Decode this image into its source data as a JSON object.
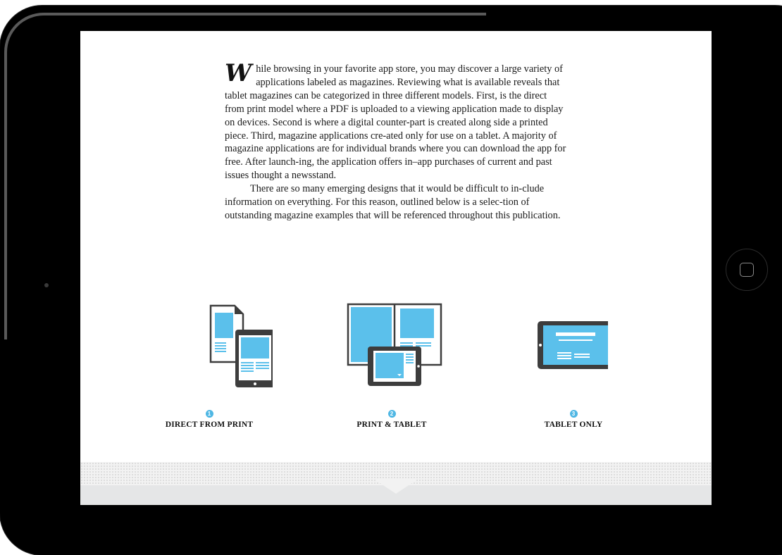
{
  "article": {
    "dropcap": "W",
    "paragraph1": "hile browsing in your favorite app store, you may discover a large variety of applications labeled as magazines. Reviewing what is available reveals that tablet magazines can be categorized in three different models. First, is the direct from print model where a PDF is uploaded to a viewing application made to display on devices. Second is where a digital counter-part is created along side a printed piece. Third, magazine applications cre-ated only for use on a tablet. A majority of magazine applications are for individual brands where you can download the app for free. After launch-ing, the application offers in–app purchases of current and past issues thought a newsstand.",
    "paragraph2": "There are so many emerging designs that it would be difficult to in-clude information on everything. For this reason, outlined below is a selec-tion of outstanding magazine examples that will be referenced throughout this publication."
  },
  "models": [
    {
      "number": "1",
      "label": "DIRECT FROM PRINT"
    },
    {
      "number": "2",
      "label": "PRINT & TABLET"
    },
    {
      "number": "3",
      "label": "TABLET ONLY"
    }
  ],
  "colors": {
    "accent": "#5bc0eb",
    "device": "#3d3d3d",
    "number_badge": "#4fb7e4",
    "bezel": "#000000"
  },
  "icons": {
    "model1": "print-and-tablet-pages-icon",
    "model2": "open-magazine-with-tablet-icon",
    "model3": "landscape-tablet-icon"
  }
}
